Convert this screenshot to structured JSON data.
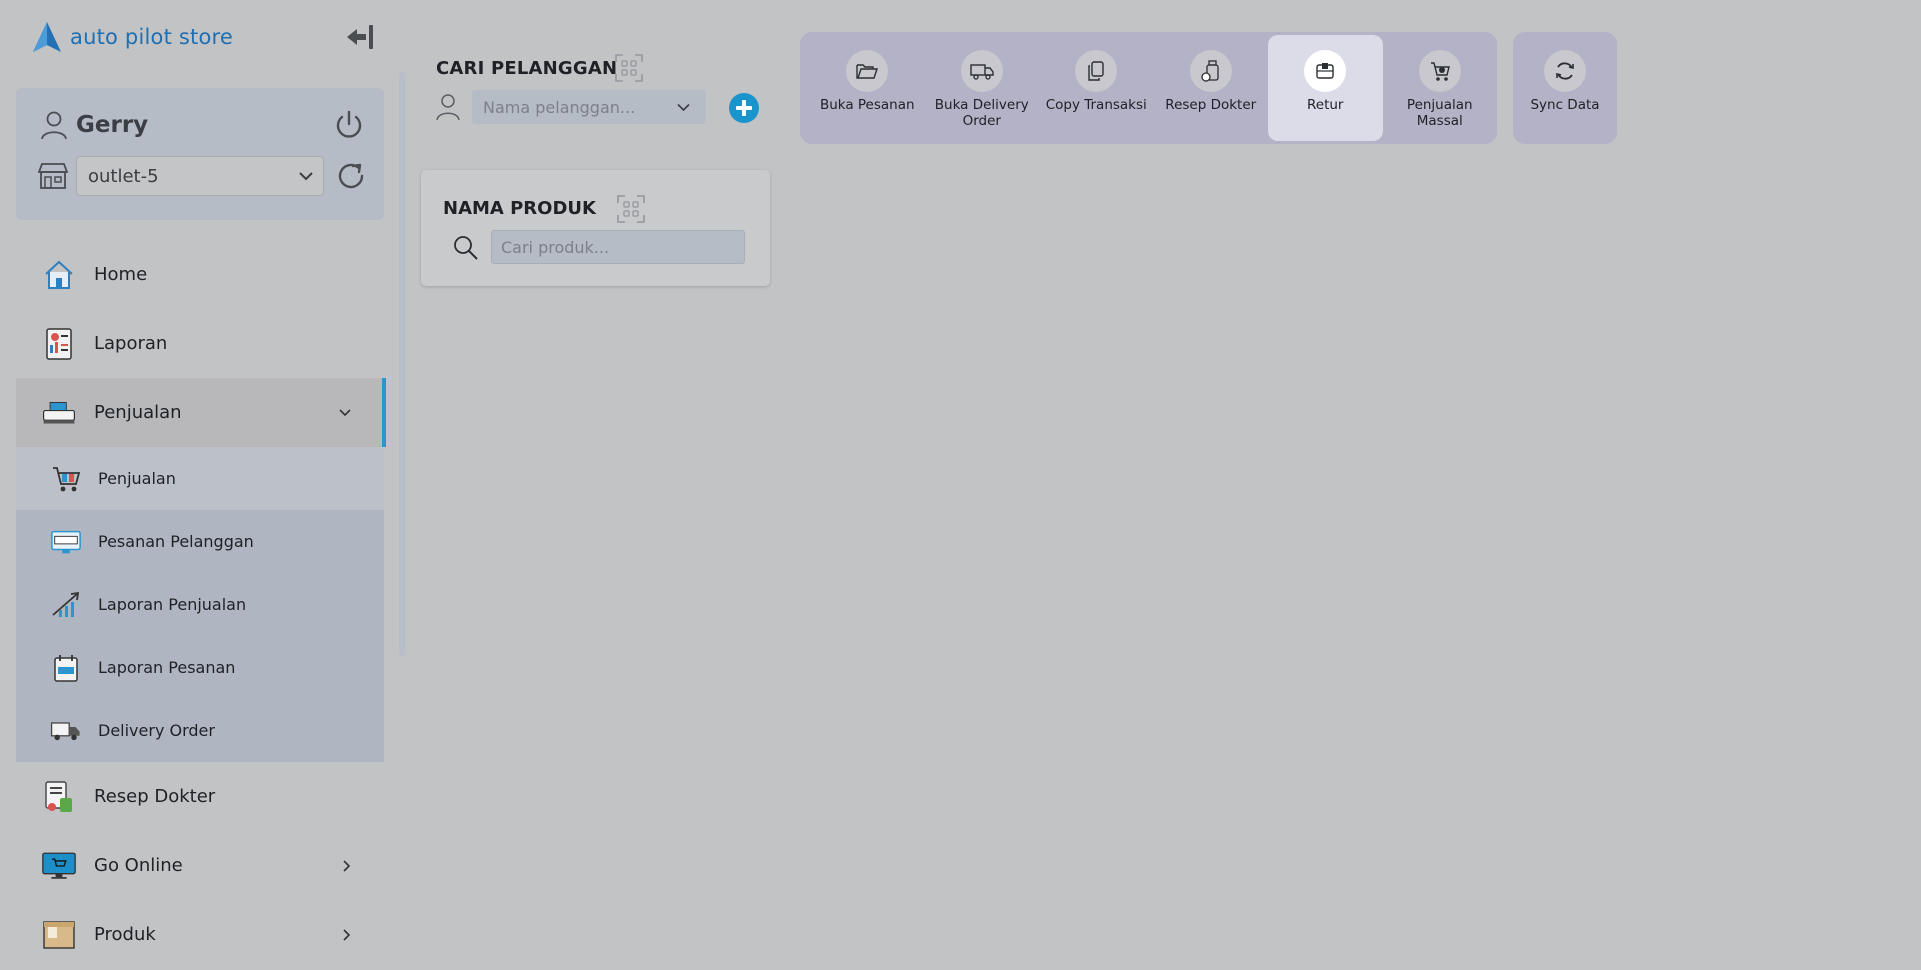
{
  "brand": {
    "name": "auto pilot store",
    "accent": "#1f6fb2"
  },
  "user": {
    "name": "Gerry"
  },
  "outlet": {
    "selected": "outlet-5"
  },
  "nav": {
    "home": "Home",
    "laporan": "Laporan",
    "penjualan": "Penjualan",
    "submenu": {
      "penjualan": "Penjualan",
      "pesanan_pelanggan": "Pesanan Pelanggan",
      "laporan_penjualan": "Laporan Penjualan",
      "laporan_pesanan": "Laporan Pesanan",
      "delivery_order": "Delivery Order"
    },
    "resep_dokter": "Resep Dokter",
    "go_online": "Go Online",
    "produk": "Produk"
  },
  "customer": {
    "title": "CARI PELANGGAN",
    "placeholder": "Nama pelanggan..."
  },
  "product": {
    "title": "NAMA PRODUK",
    "placeholder": "Cari produk..."
  },
  "toolbar": {
    "buka_pesanan": "Buka Pesanan",
    "buka_delivery_order": "Buka Delivery Order",
    "copy_transaksi": "Copy Transaksi",
    "resep_dokter": "Resep Dokter",
    "retur": "Retur",
    "penjualan_massal": "Penjualan Massal",
    "sync_data": "Sync Data"
  },
  "icons": {
    "collapse": "collapse-sidebar-icon",
    "power": "power-icon",
    "refresh": "refresh-icon",
    "store": "store-icon",
    "user": "user-icon",
    "scan": "barcode-scan-icon",
    "search": "search-icon",
    "add": "plus-icon"
  }
}
